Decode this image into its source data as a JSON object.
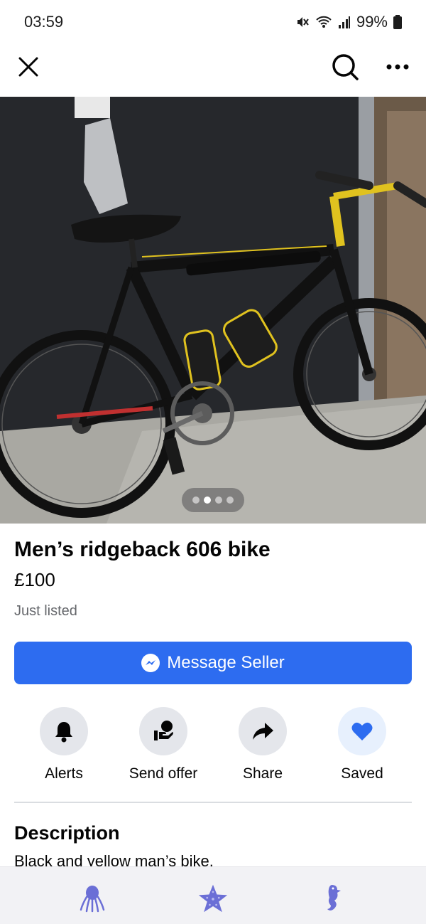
{
  "status_bar": {
    "time": "03:59",
    "battery": "99%",
    "icons": [
      "mute-icon",
      "wifi-icon",
      "signal-icon",
      "battery-icon"
    ]
  },
  "top_bar": {
    "icons": [
      "close-icon",
      "search-icon",
      "more-icon"
    ]
  },
  "photo": {
    "pager": {
      "count": 4,
      "active_index": 1
    }
  },
  "listing": {
    "title": "Men’s ridgeback 606 bike",
    "price": "£100",
    "status": "Just listed",
    "message_button": "Message Seller"
  },
  "actions": [
    {
      "label": "Alerts",
      "icon": "bell-icon"
    },
    {
      "label": "Send offer",
      "icon": "send-offer-icon"
    },
    {
      "label": "Share",
      "icon": "share-icon"
    },
    {
      "label": "Saved",
      "icon": "heart-icon"
    }
  ],
  "description": {
    "heading": "Description",
    "text": "Black and yellow man’s bike."
  },
  "bottom_nav": {
    "icons": [
      "octopus-icon",
      "starfish-icon",
      "seahorse-icon"
    ]
  },
  "colors": {
    "accent": "#2d6cf0",
    "saved_heart": "#2d6cf0",
    "nav_icon": "#6b6fd6",
    "secondary_text": "#65676b"
  }
}
